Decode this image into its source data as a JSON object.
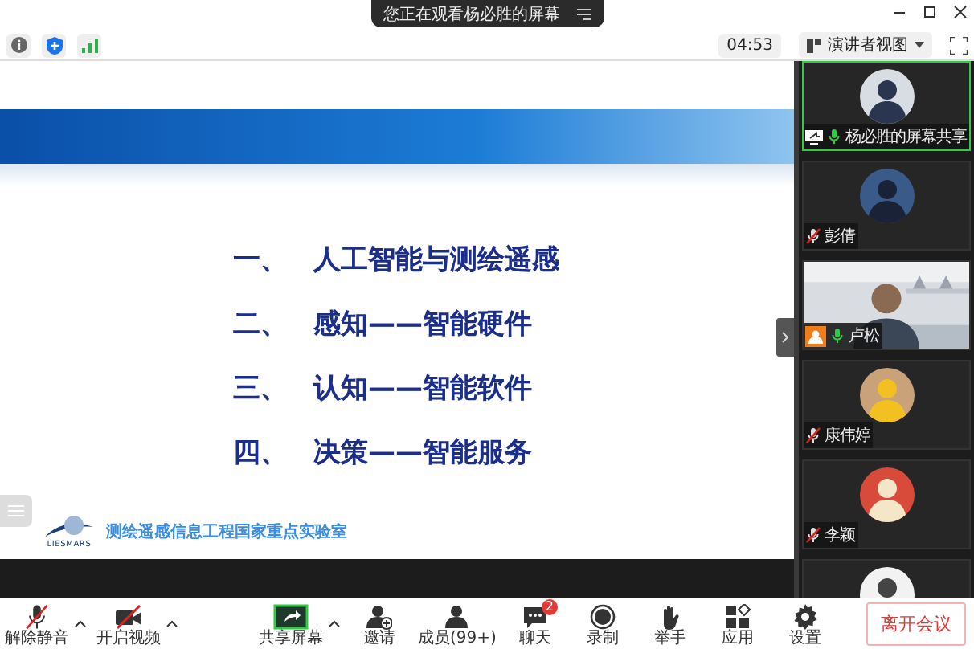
{
  "banner": {
    "text": "您正在观看杨必胜的屏幕"
  },
  "toolbar": {
    "timer": "04:53",
    "view_button": "演讲者视图"
  },
  "slide": {
    "items": [
      {
        "number": "一、",
        "text": "人工智能与测绘遥感"
      },
      {
        "number": "二、",
        "text": "感知——智能硬件"
      },
      {
        "number": "三、",
        "text": "认知——智能软件"
      },
      {
        "number": "四、",
        "text": "决策——智能服务"
      }
    ],
    "logo_text": "LIESMARS",
    "lab_name": "测绘遥感信息工程国家重点实验室"
  },
  "participants": [
    {
      "kind": "avatar",
      "name": "杨必胜的屏幕共享",
      "muted": false,
      "sharing": true,
      "active": true,
      "host": false
    },
    {
      "kind": "avatar",
      "name": "彭倩",
      "muted": true,
      "sharing": false,
      "active": false,
      "host": false
    },
    {
      "kind": "video",
      "name": "卢松",
      "muted": false,
      "sharing": false,
      "active": false,
      "host": true
    },
    {
      "kind": "avatar",
      "name": "康伟婷",
      "muted": true,
      "sharing": false,
      "active": false,
      "host": false
    },
    {
      "kind": "avatar",
      "name": "李颖",
      "muted": true,
      "sharing": false,
      "active": false,
      "host": false
    },
    {
      "kind": "avatar",
      "active": false
    }
  ],
  "controls": [
    {
      "kind": "mic",
      "label": "解除静音",
      "off": true,
      "menu": true
    },
    {
      "kind": "video",
      "label": "开启视频",
      "off": true,
      "menu": true
    },
    {
      "kind": "share",
      "label": "共享屏幕",
      "menu": true
    },
    {
      "kind": "invite",
      "label": "邀请",
      "menu": false
    },
    {
      "kind": "members",
      "label": "成员(99+)",
      "menu": false
    },
    {
      "kind": "chat",
      "label": "聊天",
      "badge": "2",
      "menu": false
    },
    {
      "kind": "record",
      "label": "录制",
      "menu": false
    },
    {
      "kind": "hand",
      "label": "举手",
      "menu": false
    },
    {
      "kind": "apps",
      "label": "应用",
      "menu": false
    },
    {
      "kind": "settings",
      "label": "设置",
      "menu": false
    }
  ],
  "leave_button": "离开会议"
}
